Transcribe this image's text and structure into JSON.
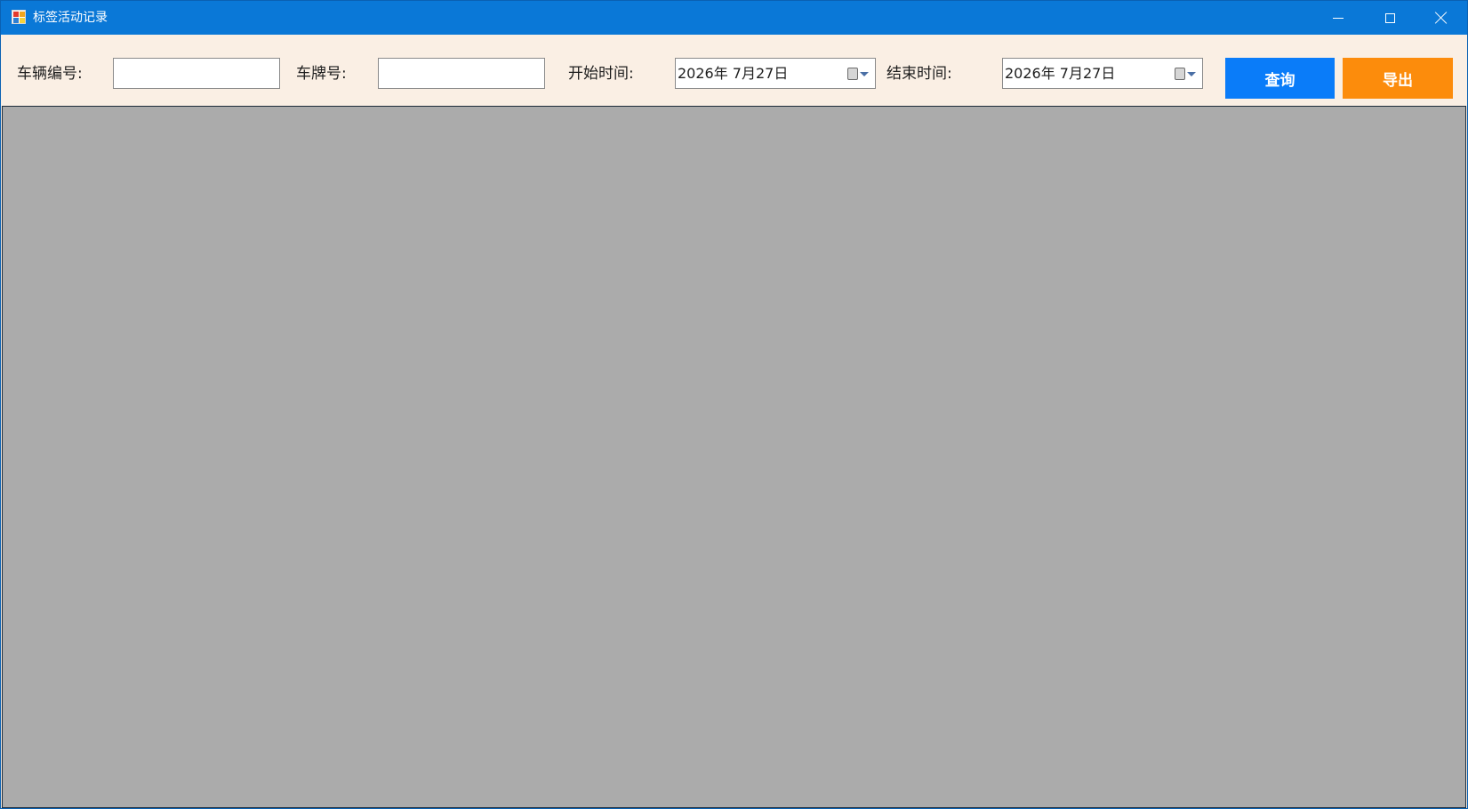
{
  "window": {
    "title": "标签活动记录",
    "buttons": {
      "minimize": "minimize-icon",
      "maximize": "maximize-icon",
      "close": "close-icon"
    },
    "title_bar_color": "#0a78d7"
  },
  "toolbar": {
    "vehicle_no_label": "车辆编号:",
    "vehicle_no_value": "",
    "plate_no_label": "车牌号:",
    "plate_no_value": "",
    "start_time_label": "开始时间:",
    "start_time_value": "2026年  7月27日",
    "end_time_label": "结束时间:",
    "end_time_value": "2026年  7月27日",
    "query_button": "查询",
    "export_button": "导出",
    "background_color": "#faefe4"
  },
  "colors": {
    "query_button": "#0a7cf9",
    "export_button": "#fc8c0c",
    "content_background": "#ababab"
  }
}
